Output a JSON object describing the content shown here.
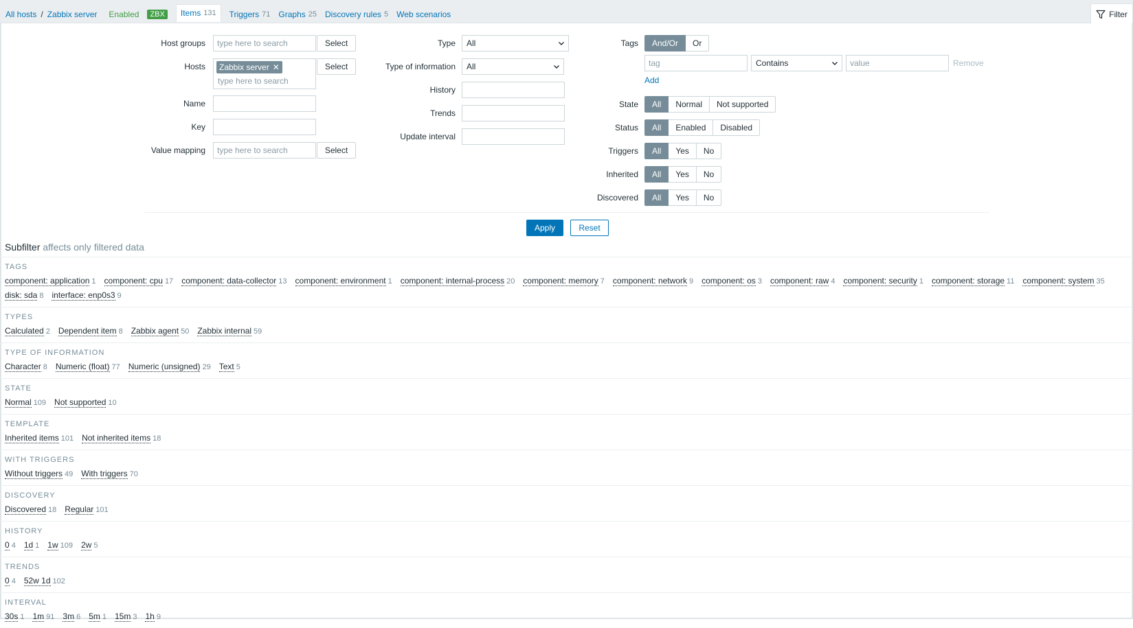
{
  "nav": {
    "all_hosts": "All hosts",
    "separator": "/",
    "host": "Zabbix server",
    "status": "Enabled",
    "zbx": "ZBX",
    "tabs": [
      {
        "label": "Items",
        "count": "131"
      },
      {
        "label": "Triggers",
        "count": "71"
      },
      {
        "label": "Graphs",
        "count": "25"
      },
      {
        "label": "Discovery rules",
        "count": "5"
      },
      {
        "label": "Web scenarios",
        "count": ""
      }
    ],
    "filter_label": "Filter"
  },
  "filter": {
    "host_groups_label": "Host groups",
    "hosts_label": "Hosts",
    "name_label": "Name",
    "key_label": "Key",
    "value_mapping_label": "Value mapping",
    "search_placeholder": "type here to search",
    "select_label": "Select",
    "host_chip": "Zabbix server",
    "type_label": "Type",
    "type_value": "All",
    "type_of_info_label": "Type of information",
    "type_of_info_value": "All",
    "history_label": "History",
    "trends_label": "Trends",
    "update_interval_label": "Update interval",
    "tags_label": "Tags",
    "tags_andor": "And/Or",
    "tags_or": "Or",
    "tag_placeholder": "tag",
    "tag_operator": "Contains",
    "value_placeholder": "value",
    "remove_label": "Remove",
    "add_label": "Add",
    "state_label": "State",
    "state_options": [
      "All",
      "Normal",
      "Not supported"
    ],
    "status_label": "Status",
    "status_options": [
      "All",
      "Enabled",
      "Disabled"
    ],
    "triggers_label": "Triggers",
    "inherited_label": "Inherited",
    "discovered_label": "Discovered",
    "yn_options": [
      "All",
      "Yes",
      "No"
    ],
    "apply_label": "Apply",
    "reset_label": "Reset"
  },
  "subfilter": {
    "title": "Subfilter",
    "note": "affects only filtered data",
    "groups": [
      {
        "title": "TAGS",
        "items": [
          {
            "name": "component: application",
            "count": "1"
          },
          {
            "name": "component: cpu",
            "count": "17"
          },
          {
            "name": "component: data-collector",
            "count": "13"
          },
          {
            "name": "component: environment",
            "count": "1"
          },
          {
            "name": "component: internal-process",
            "count": "20"
          },
          {
            "name": "component: memory",
            "count": "7"
          },
          {
            "name": "component: network",
            "count": "9"
          },
          {
            "name": "component: os",
            "count": "3"
          },
          {
            "name": "component: raw",
            "count": "4"
          },
          {
            "name": "component: security",
            "count": "1"
          },
          {
            "name": "component: storage",
            "count": "11"
          },
          {
            "name": "component: system",
            "count": "35"
          },
          {
            "name": "disk: sda",
            "count": "8"
          },
          {
            "name": "interface: enp0s3",
            "count": "9"
          }
        ]
      },
      {
        "title": "TYPES",
        "items": [
          {
            "name": "Calculated",
            "count": "2"
          },
          {
            "name": "Dependent item",
            "count": "8"
          },
          {
            "name": "Zabbix agent",
            "count": "50"
          },
          {
            "name": "Zabbix internal",
            "count": "59"
          }
        ]
      },
      {
        "title": "TYPE OF INFORMATION",
        "items": [
          {
            "name": "Character",
            "count": "8"
          },
          {
            "name": "Numeric (float)",
            "count": "77"
          },
          {
            "name": "Numeric (unsigned)",
            "count": "29"
          },
          {
            "name": "Text",
            "count": "5"
          }
        ]
      },
      {
        "title": "STATE",
        "items": [
          {
            "name": "Normal",
            "count": "109"
          },
          {
            "name": "Not supported",
            "count": "10"
          }
        ]
      },
      {
        "title": "TEMPLATE",
        "items": [
          {
            "name": "Inherited items",
            "count": "101"
          },
          {
            "name": "Not inherited items",
            "count": "18"
          }
        ]
      },
      {
        "title": "WITH TRIGGERS",
        "items": [
          {
            "name": "Without triggers",
            "count": "49"
          },
          {
            "name": "With triggers",
            "count": "70"
          }
        ]
      },
      {
        "title": "DISCOVERY",
        "items": [
          {
            "name": "Discovered",
            "count": "18"
          },
          {
            "name": "Regular",
            "count": "101"
          }
        ]
      },
      {
        "title": "HISTORY",
        "items": [
          {
            "name": "0",
            "count": "4"
          },
          {
            "name": "1d",
            "count": "1"
          },
          {
            "name": "1w",
            "count": "109"
          },
          {
            "name": "2w",
            "count": "5"
          }
        ]
      },
      {
        "title": "TRENDS",
        "items": [
          {
            "name": "0",
            "count": "4"
          },
          {
            "name": "52w 1d",
            "count": "102"
          }
        ]
      },
      {
        "title": "INTERVAL",
        "items": [
          {
            "name": "30s",
            "count": "1"
          },
          {
            "name": "1m",
            "count": "91"
          },
          {
            "name": "3m",
            "count": "6"
          },
          {
            "name": "5m",
            "count": "1"
          },
          {
            "name": "15m",
            "count": "3"
          },
          {
            "name": "1h",
            "count": "9"
          }
        ]
      }
    ]
  },
  "colors": {
    "link": "#0275b8",
    "enabled": "#429e47",
    "segment_active": "#768d99",
    "muted": "#768d99"
  }
}
